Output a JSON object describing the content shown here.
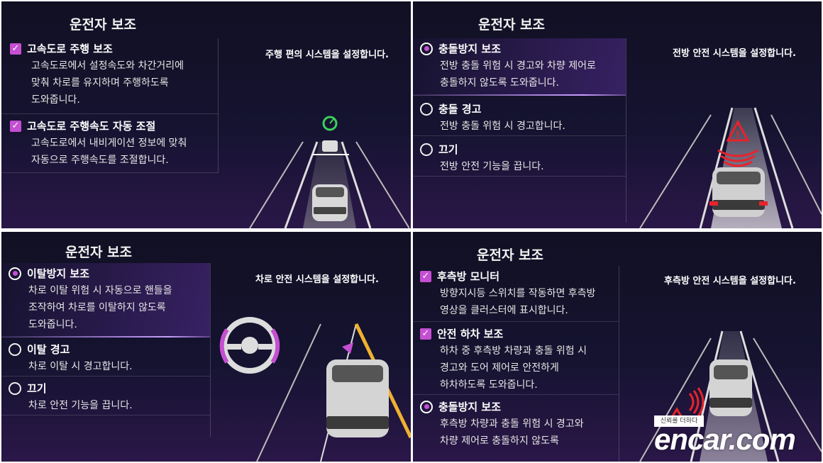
{
  "panel1": {
    "title": "운전자 보조",
    "caption": "주행 편의 시스템을 설정합니다.",
    "items": [
      {
        "label": "고속도로 주행 보조",
        "desc": [
          "고속도로에서 설정속도와 차간거리에",
          "맞춰 차로를 유지하며 주행하도록",
          "도와줍니다."
        ]
      },
      {
        "label": "고속도로 주행속도 자동 조절",
        "desc": [
          "고속도로에서 내비게이션 정보에 맞춰",
          "자동으로 주행속도를 조절합니다."
        ]
      }
    ]
  },
  "panel2": {
    "title": "운전자 보조",
    "caption": "전방 안전 시스템을 설정합니다.",
    "items": [
      {
        "label": "충돌방지 보조",
        "desc": [
          "전방 충돌 위험 시 경고와 차량 제어로",
          "충돌하지 않도록 도와줍니다."
        ]
      },
      {
        "label": "충돌 경고",
        "desc": [
          "전방 충돌 위험 시 경고합니다."
        ]
      },
      {
        "label": "끄기",
        "desc": [
          "전방 안전 기능을 끕니다."
        ]
      }
    ]
  },
  "panel3": {
    "title": "운전자 보조",
    "caption": "차로 안전 시스템을 설정합니다.",
    "items": [
      {
        "label": "이탈방지 보조",
        "desc": [
          "차로 이탈 위험 시 자동으로 핸들을",
          "조작하여 차로를 이탈하지 않도록",
          "도와줍니다."
        ]
      },
      {
        "label": "이탈 경고",
        "desc": [
          "차로 이탈 시 경고합니다."
        ]
      },
      {
        "label": "끄기",
        "desc": [
          "차로 안전 기능을 끕니다."
        ]
      }
    ]
  },
  "panel4": {
    "title": "운전자 보조",
    "caption": "후측방 안전 시스템을 설정합니다.",
    "items": [
      {
        "label": "후측방 모니터",
        "desc": [
          "방향지시등 스위치를 작동하면 후측방",
          "영상을 클러스터에 표시합니다."
        ]
      },
      {
        "label": "안전 하차 보조",
        "desc": [
          "하차 중 후측방 차량과 충돌 위험 시",
          "경고와 도어 제어로 안전하게",
          "하차하도록 도와줍니다."
        ]
      },
      {
        "label": "충돌방지 보조",
        "desc": [
          "후측방 차량과 충돌 위험 시 경고와",
          "차량 제어로 충돌하지 않도록"
        ]
      }
    ]
  },
  "watermark": {
    "badge": "신뢰를 더하다",
    "brand": "encar.com"
  },
  "colors": {
    "accent": "#c54fd2",
    "warning": "#e8232a",
    "lane_yellow": "#f0b030",
    "assist_green": "#3ad15a"
  }
}
